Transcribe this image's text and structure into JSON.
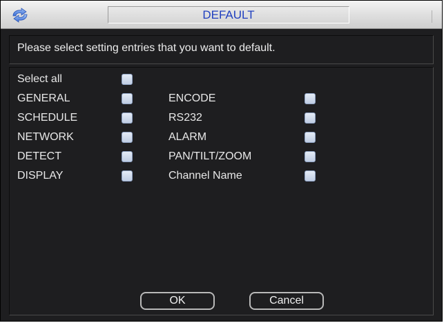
{
  "dialog": {
    "title": "DEFAULT",
    "instruction": "Please select setting entries that you want to default."
  },
  "select_all": {
    "label": "Select all",
    "checked": false
  },
  "entries_left": [
    {
      "label": "GENERAL",
      "checked": false
    },
    {
      "label": "SCHEDULE",
      "checked": false
    },
    {
      "label": "NETWORK",
      "checked": false
    },
    {
      "label": "DETECT",
      "checked": false
    },
    {
      "label": "DISPLAY",
      "checked": false
    }
  ],
  "entries_right": [
    {
      "label": "ENCODE",
      "checked": false
    },
    {
      "label": "RS232",
      "checked": false
    },
    {
      "label": "ALARM",
      "checked": false
    },
    {
      "label": "PAN/TILT/ZOOM",
      "checked": false
    },
    {
      "label": "Channel Name",
      "checked": false
    }
  ],
  "buttons": {
    "ok": "OK",
    "cancel": "Cancel"
  },
  "colors": {
    "title_text": "#1f3fbf",
    "background": "#1e1e20",
    "text": "#e8e8e8",
    "checkbox": "#c9d6ea"
  },
  "icons": {
    "title_icon": "refresh-icon"
  }
}
